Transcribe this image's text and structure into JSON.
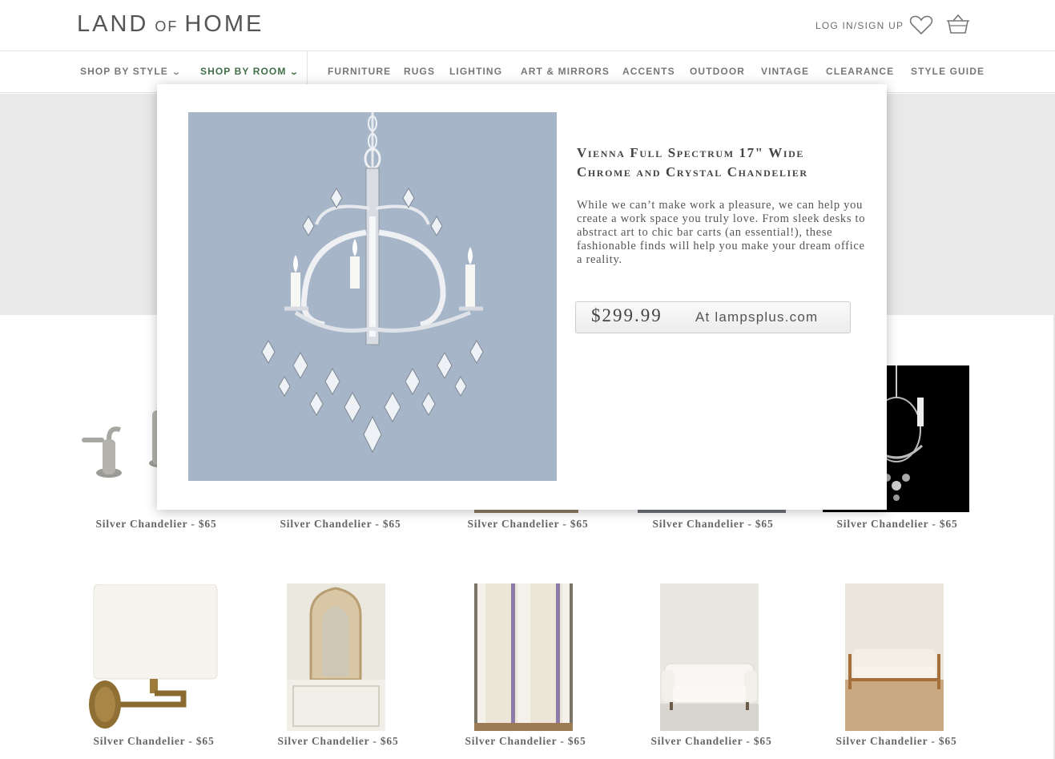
{
  "brand": {
    "land": "LAND",
    "of": "OF",
    "home": "HOME"
  },
  "header": {
    "login_label": "LOG IN/SIGN UP",
    "wishlist_icon": "heart-icon",
    "cart_icon": "basket-icon"
  },
  "nav": {
    "items": [
      {
        "label": "SHOP BY STYLE",
        "has_dropdown": true,
        "active": false
      },
      {
        "label": "SHOP BY ROOM",
        "has_dropdown": true,
        "active": true
      },
      {
        "label": "FURNITURE"
      },
      {
        "label": "RUGS"
      },
      {
        "label": "LIGHTING"
      },
      {
        "label": "ART & MIRRORS"
      },
      {
        "label": "ACCENTS"
      },
      {
        "label": "OUTDOOR"
      },
      {
        "label": "VINTAGE"
      },
      {
        "label": "CLEARANCE"
      },
      {
        "label": "STYLE GUIDE"
      }
    ]
  },
  "modal": {
    "title": "Vienna Full Spectrum 17\" Wide Chrome and Crystal Chandelier",
    "description": "While we can’t make work a pleasure, we can help you create a work space you truly love. From sleek desks to abstract art to chic bar carts (an essential!), these fashionable finds will help you make your dream office a reality.",
    "price": "$299.99",
    "source": "At lampsplus.com"
  },
  "products": [
    {
      "label": "Silver Chandelier - $65",
      "image": "faucet"
    },
    {
      "label": "Silver Chandelier - $65",
      "image": "hidden"
    },
    {
      "label": "Silver Chandelier - $65",
      "image": "hidden"
    },
    {
      "label": "Silver Chandelier - $65",
      "image": "hidden"
    },
    {
      "label": "Silver Chandelier - $65",
      "image": "chandelier-black"
    },
    {
      "label": "Silver Chandelier - $65",
      "image": "wall-lamp"
    },
    {
      "label": "Silver Chandelier - $65",
      "image": "carved-mirror"
    },
    {
      "label": "Silver Chandelier - $65",
      "image": "curtain"
    },
    {
      "label": "Silver Chandelier - $65",
      "image": "tufted-sofa"
    },
    {
      "label": "Silver Chandelier - $65",
      "image": "wood-sofa"
    }
  ],
  "colors": {
    "accent": "#3f6e48",
    "hero_bg": "#e9e9e9",
    "modal_img_bg": "#a4b4c6"
  }
}
